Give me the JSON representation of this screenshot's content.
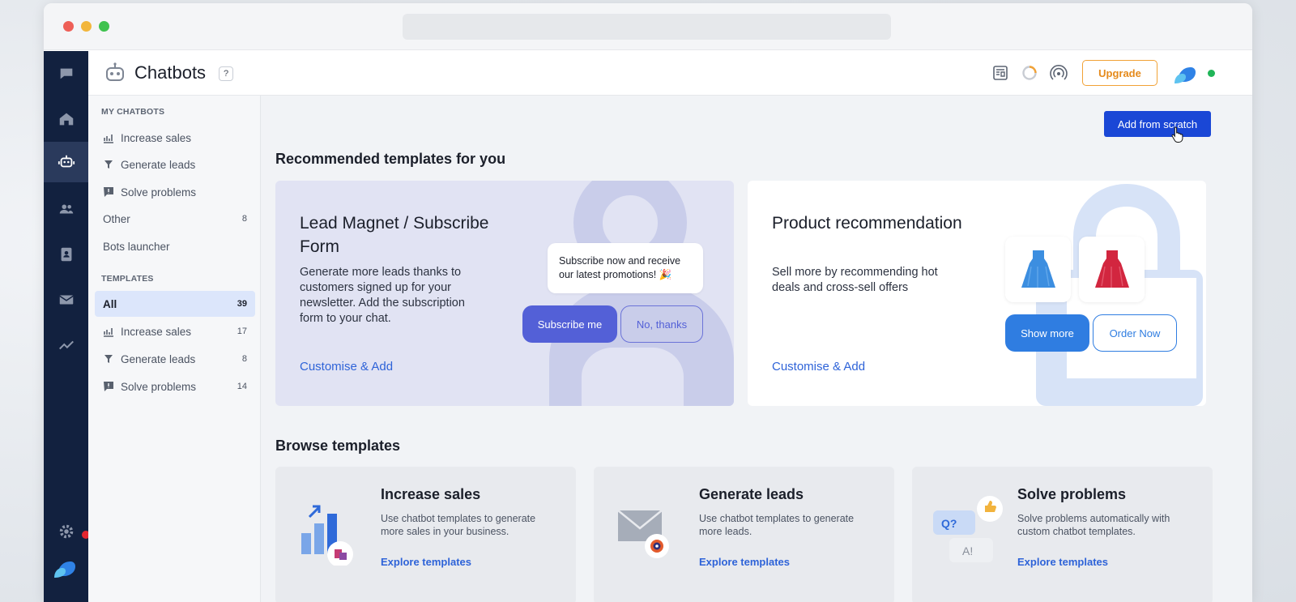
{
  "app": {
    "title": "Chatbots",
    "help": "?",
    "upgrade_label": "Upgrade"
  },
  "sidebar": {
    "my_chatbots_heading": "MY CHATBOTS",
    "my_chatbots": [
      {
        "label": "Increase sales",
        "icon": "growth-icon"
      },
      {
        "label": "Generate leads",
        "icon": "funnel-icon"
      },
      {
        "label": "Solve problems",
        "icon": "alert-chat-icon"
      },
      {
        "label": "Other",
        "count": "8"
      },
      {
        "label": "Bots launcher"
      }
    ],
    "templates_heading": "TEMPLATES",
    "templates": [
      {
        "label": "All",
        "count": "39",
        "active": true
      },
      {
        "label": "Increase sales",
        "count": "17",
        "icon": "growth-icon"
      },
      {
        "label": "Generate leads",
        "count": "8",
        "icon": "funnel-icon"
      },
      {
        "label": "Solve problems",
        "count": "14",
        "icon": "alert-chat-icon"
      }
    ]
  },
  "main": {
    "add_button": "Add from scratch",
    "recommended_title": "Recommended templates for you",
    "recommended": [
      {
        "title": "Lead Magnet / Subscribe Form",
        "description": "Generate more leads thanks to customers signed up for your newsletter. Add the subscription form to your chat.",
        "link": "Customise & Add",
        "bubble": "Subscribe now and receive our latest promotions! 🎉",
        "primary": "Subscribe me",
        "secondary": "No, thanks"
      },
      {
        "title": "Product recommendation",
        "description": "Sell more by recommending hot deals and cross-sell offers",
        "link": "Customise & Add",
        "primary": "Show more",
        "secondary": "Order Now"
      }
    ],
    "browse_title": "Browse templates",
    "browse": [
      {
        "title": "Increase sales",
        "description": "Use chatbot templates to generate more sales in your business.",
        "link": "Explore templates"
      },
      {
        "title": "Generate leads",
        "description": "Use chatbot templates to generate more leads.",
        "link": "Explore templates"
      },
      {
        "title": "Solve problems",
        "description": "Solve problems automatically with custom chatbot templates.",
        "link": "Explore templates",
        "q_label": "Q?",
        "a_label": "A!"
      }
    ]
  },
  "colors": {
    "rail": "#12213f",
    "accent": "#1a47d6",
    "upgrade": "#f1a236",
    "lead_card": "#e1e3f3",
    "chat_primary": "#5360d7",
    "product_primary": "#2f7de1"
  }
}
